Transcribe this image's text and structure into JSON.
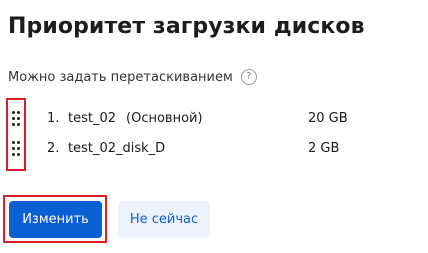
{
  "title": "Приоритет загрузки дисков",
  "hint": {
    "text": "Можно задать перетаскиванием",
    "help_icon": "?"
  },
  "disks": [
    {
      "index": "1.",
      "name": "test_02",
      "note": "(Основной)",
      "size": "20 GB"
    },
    {
      "index": "2.",
      "name": "test_02_disk_D",
      "note": "",
      "size": "2 GB"
    }
  ],
  "actions": {
    "change_label": "Изменить",
    "not_now_label": "Не сейчас"
  },
  "colors": {
    "primary": "#0a5fd3",
    "secondary_bg": "#eef3fb",
    "highlight": "#d42027",
    "text": "#1a1a1a"
  },
  "icons": {
    "drag": "drag-handle-icon",
    "help": "help-icon"
  }
}
